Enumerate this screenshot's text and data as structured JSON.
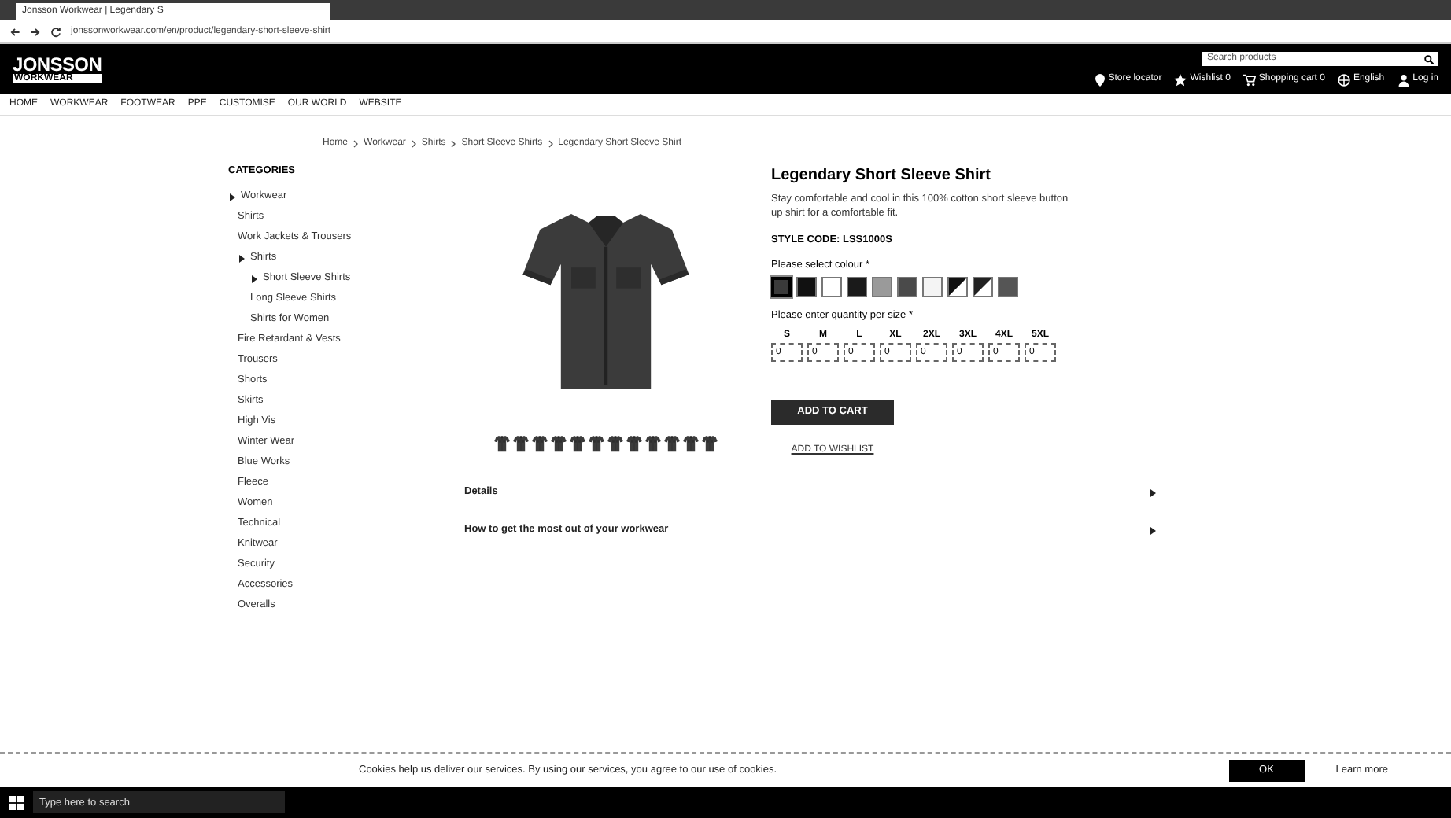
{
  "browser": {
    "tab_title": "Jonsson Workwear | Legendary S",
    "url": "jonssonworkwear.com/en/product/legendary-short-sleeve-shirt"
  },
  "header": {
    "logo_top": "JONSSON",
    "logo_bottom": "WORKWEAR",
    "search": {
      "placeholder": "Search products"
    },
    "links": [
      {
        "kind": "pin",
        "label": "Store locator"
      },
      {
        "kind": "star",
        "label": "Wishlist 0"
      },
      {
        "kind": "cart",
        "label": "Shopping cart 0"
      },
      {
        "kind": "globe",
        "label": "English"
      },
      {
        "kind": "user",
        "label": "Log in"
      }
    ]
  },
  "nav": [
    {
      "label": "HOME"
    },
    {
      "label": "WORKWEAR"
    },
    {
      "label": "FOOTWEAR"
    },
    {
      "label": "PPE"
    },
    {
      "label": "CUSTOMISE"
    },
    {
      "label": "OUR WORLD"
    },
    {
      "label": "WEBSITE"
    }
  ],
  "breadcrumb": [
    "Home",
    "Workwear",
    "Shirts",
    "Short Sleeve Shirts",
    "Legendary Short Sleeve Shirt"
  ],
  "categories": {
    "title": "CATEGORIES",
    "items": [
      {
        "label": "Workwear",
        "expanded": true,
        "children": [
          {
            "label": "Shirts",
            "expanded": false
          },
          {
            "label": "Work Jackets & Trousers",
            "expanded": false
          },
          {
            "label": "Shirts",
            "expanded": true,
            "children": [
              {
                "label": "Short Sleeve Shirts",
                "expanded": true
              },
              {
                "label": "Long Sleeve Shirts",
                "expanded": false
              },
              {
                "label": "Shirts for Women",
                "expanded": false
              }
            ]
          },
          {
            "label": "Fire Retardant & Vests",
            "expanded": false
          },
          {
            "label": "Trousers",
            "expanded": false
          },
          {
            "label": "Shorts",
            "expanded": false
          },
          {
            "label": "Skirts",
            "expanded": false
          },
          {
            "label": "High Vis",
            "expanded": false
          },
          {
            "label": "Winter Wear",
            "expanded": false
          },
          {
            "label": "Blue Works",
            "expanded": false
          },
          {
            "label": "Fleece",
            "expanded": false
          },
          {
            "label": "Women",
            "expanded": false
          },
          {
            "label": "Technical",
            "expanded": false
          },
          {
            "label": "Knitwear",
            "expanded": false
          },
          {
            "label": "Security",
            "expanded": false
          },
          {
            "label": "Accessories",
            "expanded": false
          },
          {
            "label": "Overalls",
            "expanded": false
          }
        ]
      }
    ]
  },
  "product": {
    "title": "Legendary Short Sleeve Shirt",
    "description": "Stay comfortable and cool in this 100% cotton short sleeve button up shirt for a comfortable fit.",
    "style_code": "STYLE CODE: LSS1000S",
    "colour_label": "Please select colour *",
    "swatches": [
      {
        "kind": "solid",
        "color": "#3a3a3a",
        "selected": true
      },
      {
        "kind": "solid",
        "color": "#111111",
        "selected": false
      },
      {
        "kind": "solid",
        "color": "#ffffff",
        "selected": false
      },
      {
        "kind": "solid",
        "color": "#1a1a1a",
        "selected": false
      },
      {
        "kind": "solid",
        "color": "#9a9a9a",
        "selected": false
      },
      {
        "kind": "solid",
        "color": "#4a4a4a",
        "selected": false
      },
      {
        "kind": "solid",
        "color": "#f4f4f4",
        "selected": false
      },
      {
        "kind": "split",
        "color": "#111111",
        "selected": false
      },
      {
        "kind": "split",
        "color": "#222222",
        "selected": false
      },
      {
        "kind": "solid",
        "color": "#555555",
        "selected": false
      }
    ],
    "quantity_label": "Please enter quantity per size *",
    "sizes": [
      {
        "size": "S",
        "qty": "0"
      },
      {
        "size": "M",
        "qty": "0"
      },
      {
        "size": "L",
        "qty": "0"
      },
      {
        "size": "XL",
        "qty": "0"
      },
      {
        "size": "2XL",
        "qty": "0"
      },
      {
        "size": "3XL",
        "qty": "0"
      },
      {
        "size": "4XL",
        "qty": "0"
      },
      {
        "size": "5XL",
        "qty": "0"
      }
    ],
    "add_to_cart": "ADD TO CART",
    "add_to_wishlist": "ADD TO WISHLIST"
  },
  "accordion": [
    {
      "label": "Details",
      "expanded": false
    },
    {
      "label": "How to get the most out of your workwear",
      "expanded": false
    }
  ],
  "cookie_bar": {
    "text": "Cookies help us deliver our services. By using our services, you agree to our use of cookies.",
    "ok": "OK",
    "learn_more": "Learn more"
  },
  "taskbar": {
    "search_placeholder": "Type here to search"
  }
}
